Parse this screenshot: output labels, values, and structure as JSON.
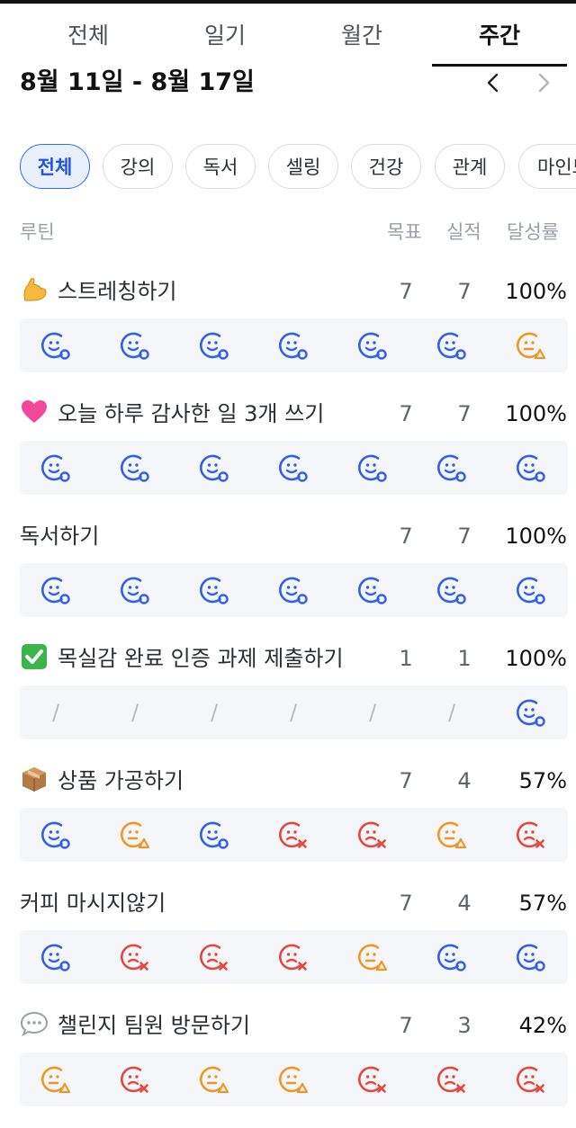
{
  "tabs": [
    {
      "label": "전체",
      "active": false
    },
    {
      "label": "일기",
      "active": false
    },
    {
      "label": "월간",
      "active": false
    },
    {
      "label": "주간",
      "active": true
    }
  ],
  "week_range": "8월 11일 - 8월 17일",
  "chips": [
    {
      "label": "전체",
      "active": true
    },
    {
      "label": "강의",
      "active": false
    },
    {
      "label": "독서",
      "active": false
    },
    {
      "label": "셀링",
      "active": false
    },
    {
      "label": "건강",
      "active": false
    },
    {
      "label": "관계",
      "active": false
    },
    {
      "label": "마인드",
      "active": false
    }
  ],
  "columns": {
    "routine": "루틴",
    "goal": "목표",
    "actual": "실적",
    "rate": "달성률"
  },
  "colors": {
    "done": "#2f5ef0",
    "partial": "#f0961e",
    "missed": "#e5473c",
    "empty": "#b6bbc3"
  },
  "routines": [
    {
      "emoji": "flexed-biceps",
      "title": "스트레칭하기",
      "goal": "7",
      "actual": "7",
      "rate": "100%",
      "days": [
        "done",
        "done",
        "done",
        "done",
        "done",
        "done",
        "partial"
      ]
    },
    {
      "emoji": "pink-heart",
      "title": "오늘 하루 감사한 일 3개 쓰기",
      "goal": "7",
      "actual": "7",
      "rate": "100%",
      "days": [
        "done",
        "done",
        "done",
        "done",
        "done",
        "done",
        "done"
      ]
    },
    {
      "emoji": "",
      "title": "독서하기",
      "goal": "7",
      "actual": "7",
      "rate": "100%",
      "days": [
        "done",
        "done",
        "done",
        "done",
        "done",
        "done",
        "done"
      ]
    },
    {
      "emoji": "check-mark-button",
      "title": "목실감 완료 인증 과제 제출하기",
      "goal": "1",
      "actual": "1",
      "rate": "100%",
      "days": [
        "none",
        "none",
        "none",
        "none",
        "none",
        "none",
        "done"
      ]
    },
    {
      "emoji": "package",
      "title": "상품 가공하기",
      "goal": "7",
      "actual": "4",
      "rate": "57%",
      "days": [
        "done",
        "partial",
        "done",
        "missed",
        "missed",
        "partial",
        "missed"
      ]
    },
    {
      "emoji": "",
      "title": "커피 마시지않기",
      "goal": "7",
      "actual": "4",
      "rate": "57%",
      "days": [
        "done",
        "missed",
        "missed",
        "missed",
        "partial",
        "done",
        "done"
      ]
    },
    {
      "emoji": "speech-bubble",
      "title": "챌린지 팀원 방문하기",
      "goal": "7",
      "actual": "3",
      "rate": "42%",
      "days": [
        "partial",
        "missed",
        "partial",
        "partial",
        "missed",
        "missed",
        "missed"
      ]
    }
  ]
}
